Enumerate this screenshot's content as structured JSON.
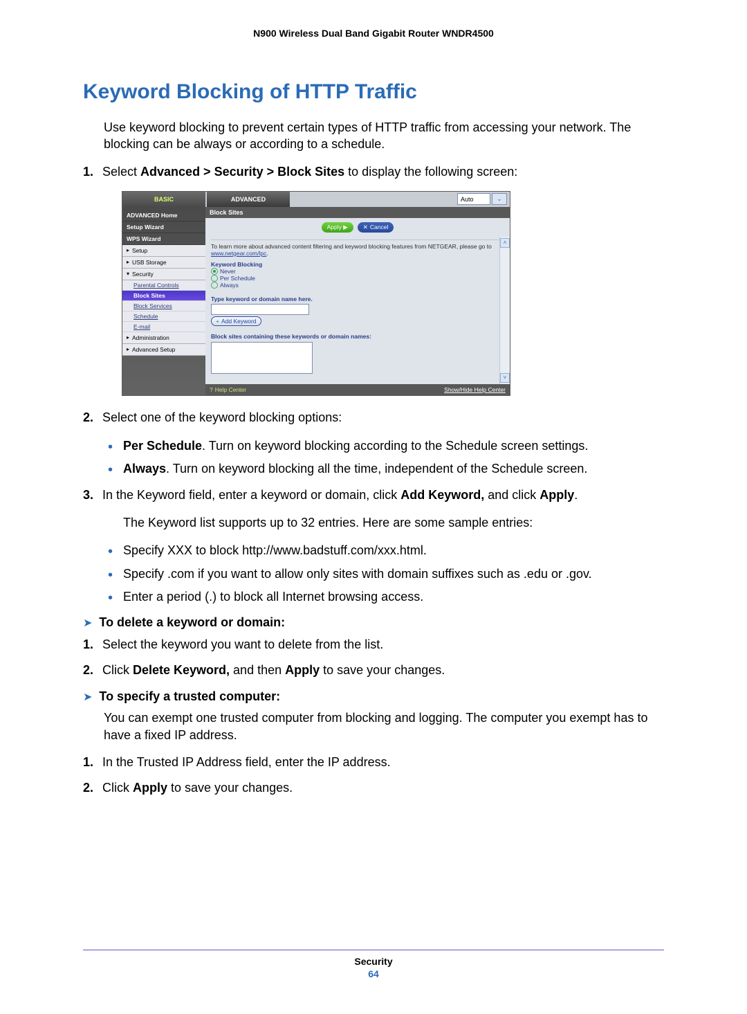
{
  "header": {
    "title": "N900 Wireless Dual Band Gigabit Router WNDR4500"
  },
  "heading": "Keyword Blocking of HTTP Traffic",
  "intro": "Use keyword blocking to prevent certain types of HTTP traffic from accessing your network. The blocking can be always or according to a schedule.",
  "step1": {
    "pre": "Select ",
    "bold": "Advanced > Security > Block Sites",
    "post": " to display the following screen:"
  },
  "screenshot": {
    "tabs": {
      "basic": "BASIC",
      "advanced": "ADVANCED"
    },
    "auto_label": "Auto",
    "sidebar": {
      "items": [
        "ADVANCED Home",
        "Setup Wizard",
        "WPS Wizard"
      ],
      "setup": "Setup",
      "usb": "USB Storage",
      "security": "Security",
      "subs": [
        "Parental Controls",
        "Block Sites",
        "Block Services",
        "Schedule",
        "E-mail"
      ],
      "admin": "Administration",
      "adv": "Advanced Setup"
    },
    "page_title": "Block Sites",
    "apply": "Apply ▶",
    "cancel": "Cancel",
    "hint_pre": "To learn more about advanced content filtering and keyword blocking features from NETGEAR, please go to ",
    "hint_link": "www.netgear.com/lpc",
    "kw_label": "Keyword Blocking",
    "opts": {
      "never": "Never",
      "per": "Per Schedule",
      "always": "Always"
    },
    "type_label": "Type keyword or domain name here.",
    "add_kw": "Add Keyword",
    "block_list_label": "Block sites containing these keywords or domain names:",
    "help": "Help Center",
    "showhide": "Show/Hide Help Center"
  },
  "step2": {
    "text": "Select one of the keyword blocking options:",
    "bullets": [
      {
        "b": "Per Schedule",
        "t": ". Turn on keyword blocking according to the Schedule screen settings."
      },
      {
        "b": "Always",
        "t": ". Turn on keyword blocking all the time, independent of the Schedule screen."
      }
    ]
  },
  "step3": {
    "pre": "In the Keyword field, enter a keyword or domain, click ",
    "b1": "Add Keyword,",
    "mid": " and click ",
    "b2": "Apply",
    "post": "."
  },
  "after3": "The Keyword list supports up to 32 entries. Here are some sample entries:",
  "samples": [
    "Specify XXX to block http://www.badstuff.com/xxx.html.",
    "Specify .com if you want to allow only sites with domain suffixes such as .edu or .gov.",
    "Enter a period (.) to block all Internet browsing access."
  ],
  "delete": {
    "heading": "To delete a keyword or domain:",
    "s1": "Select the keyword you want to delete from the list.",
    "s2_pre": "Click ",
    "s2_b1": "Delete Keyword,",
    "s2_mid": " and then ",
    "s2_b2": "Apply",
    "s2_post": " to save your changes."
  },
  "trusted": {
    "heading": "To specify a trusted computer:",
    "intro": "You can exempt one trusted computer from blocking and logging. The computer you exempt has to have a fixed IP address.",
    "s1": "In the Trusted IP Address field, enter the IP address.",
    "s2_pre": "Click ",
    "s2_b": "Apply",
    "s2_post": " to save your changes."
  },
  "footer": {
    "section": "Security",
    "page": "64"
  }
}
